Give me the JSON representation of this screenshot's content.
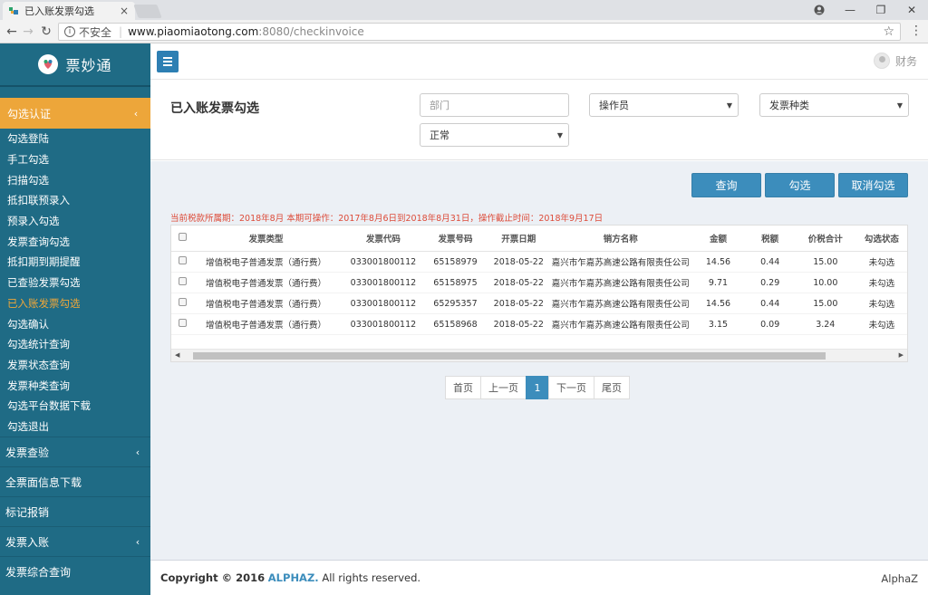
{
  "browser": {
    "tab_title": "已入账发票勾选",
    "insecure_label": "不安全",
    "url_host": "www.piaomiaotong.com",
    "url_path": ":8080/checkinvoice"
  },
  "sidebar": {
    "brand": "票妙通",
    "active_section": "勾选认证",
    "sub_items": [
      "勾选登陆",
      "手工勾选",
      "扫描勾选",
      "抵扣联预录入",
      "预录入勾选",
      "发票查询勾选",
      "抵扣期到期提醒",
      "已查验发票勾选",
      "已入账发票勾选",
      "勾选确认",
      "勾选统计查询",
      "发票状态查询",
      "发票种类查询",
      "勾选平台数据下载",
      "勾选退出"
    ],
    "current_sub_item": "已入账发票勾选",
    "menu": [
      {
        "label": "发票查验",
        "has_children": true
      },
      {
        "label": "全票面信息下载",
        "has_children": false
      },
      {
        "label": "标记报销",
        "has_children": false
      },
      {
        "label": "发票入账",
        "has_children": true
      },
      {
        "label": "发票综合查询",
        "has_children": false
      }
    ]
  },
  "topbar": {
    "user_name": "财务"
  },
  "filters": {
    "page_title": "已入账发票勾选",
    "department_placeholder": "部门",
    "operator_value": "操作员",
    "invoice_type_value": "发票种类",
    "status_value": "正常"
  },
  "actions": {
    "query": "查询",
    "check": "勾选",
    "uncheck": "取消勾选"
  },
  "notice": "当前税款所属期：2018年8月 本期可操作：2017年8月6日到2018年8月31日，操作截止时间：2018年9月17日",
  "table": {
    "headers": [
      "发票类型",
      "发票代码",
      "发票号码",
      "开票日期",
      "销方名称",
      "金额",
      "税额",
      "价税合计",
      "勾选状态"
    ],
    "rows": [
      [
        "增值税电子普通发票（通行费）",
        "033001800112",
        "65158979",
        "2018-05-22",
        "嘉兴市乍嘉苏高速公路有限责任公司",
        "14.56",
        "0.44",
        "15.00",
        "未勾选"
      ],
      [
        "增值税电子普通发票（通行费）",
        "033001800112",
        "65158975",
        "2018-05-22",
        "嘉兴市乍嘉苏高速公路有限责任公司",
        "9.71",
        "0.29",
        "10.00",
        "未勾选"
      ],
      [
        "增值税电子普通发票（通行费）",
        "033001800112",
        "65295357",
        "2018-05-22",
        "嘉兴市乍嘉苏高速公路有限责任公司",
        "14.56",
        "0.44",
        "15.00",
        "未勾选"
      ],
      [
        "增值税电子普通发票（通行费）",
        "033001800112",
        "65158968",
        "2018-05-22",
        "嘉兴市乍嘉苏高速公路有限责任公司",
        "3.15",
        "0.09",
        "3.24",
        "未勾选"
      ]
    ]
  },
  "pager": {
    "first": "首页",
    "prev": "上一页",
    "current": "1",
    "next": "下一页",
    "last": "尾页"
  },
  "footer": {
    "copyright": "Copyright © 2016",
    "brand": "ALPHAZ.",
    "rights": "All rights reserved.",
    "right_text": "AlphaZ"
  },
  "colors": {
    "sidebar": "#1f6b85",
    "accent_orange": "#eda63a",
    "primary_blue": "#3c8dbc",
    "notice_red": "#dd4b39"
  }
}
